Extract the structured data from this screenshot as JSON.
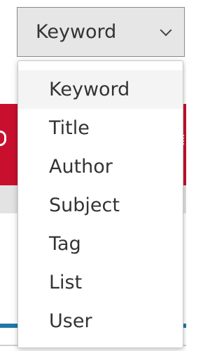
{
  "select": {
    "selected_label": "Keyword"
  },
  "menu": {
    "highlighted_index": 0,
    "items": [
      {
        "label": "Keyword"
      },
      {
        "label": "Title"
      },
      {
        "label": "Author"
      },
      {
        "label": "Subject"
      },
      {
        "label": "Tag"
      },
      {
        "label": "List"
      },
      {
        "label": "User"
      }
    ]
  },
  "colors": {
    "banner_red": "#c8102e",
    "accent_blue": "#1f78a8",
    "button_gray": "#e6e6e6"
  }
}
